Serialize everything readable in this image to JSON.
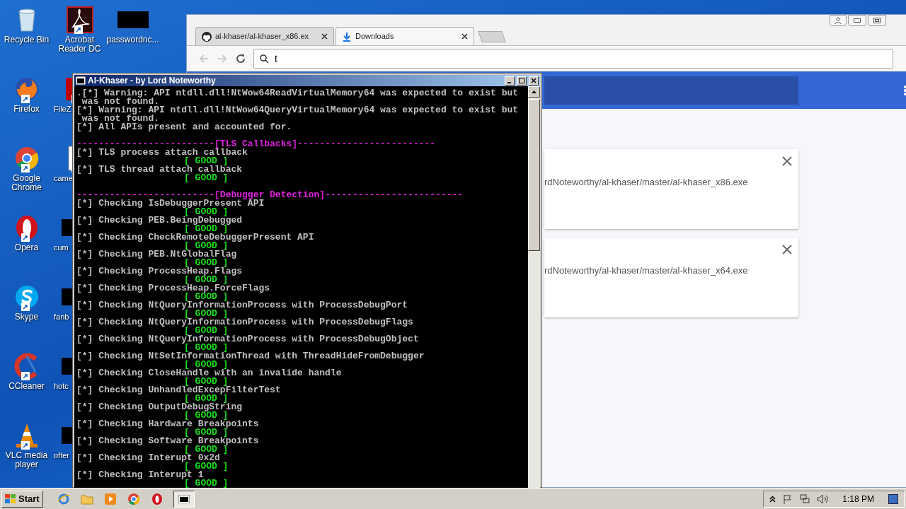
{
  "desktop_icons": [
    {
      "label": "Recycle Bin",
      "kind": "recycle"
    },
    {
      "label": "Firefox",
      "kind": "firefox"
    },
    {
      "label": "Google Chrome",
      "kind": "chrome"
    },
    {
      "label": "Opera",
      "kind": "opera"
    },
    {
      "label": "Skype",
      "kind": "skype"
    },
    {
      "label": "CCleaner",
      "kind": "ccleaner"
    },
    {
      "label": "VLC media player",
      "kind": "vlc"
    },
    {
      "label": "Acrobat Reader DC",
      "kind": "pdf"
    },
    {
      "label": "FileZ",
      "kind": "filezilla"
    },
    {
      "label": "came",
      "kind": "file"
    },
    {
      "label": "cum",
      "kind": "black"
    },
    {
      "label": "fanb",
      "kind": "black"
    },
    {
      "label": "hotc",
      "kind": "black"
    },
    {
      "label": "ofter",
      "kind": "black"
    },
    {
      "label": "passwordnc...",
      "kind": "black"
    }
  ],
  "browser": {
    "tabs": [
      {
        "label": "al-khaser/al-khaser_x86.ex",
        "kind": "github",
        "selected": false
      },
      {
        "label": "Downloads",
        "kind": "download",
        "selected": true
      }
    ],
    "omnibox": {
      "value": "t"
    },
    "downloads": [
      {
        "url": "rdNoteworthy/al-khaser/master/al-khaser_x86.exe"
      },
      {
        "url": "rdNoteworthy/al-khaser/master/al-khaser_x64.exe"
      }
    ]
  },
  "console": {
    "title": "Al-Khaser - by Lord Noteworthy",
    "lines": [
      {
        "kind": "text",
        "text": ".[*] Warning: API ntdll.dll!NtWow64ReadVirtualMemory64 was expected to exist but"
      },
      {
        "kind": "text",
        "text": " was not found."
      },
      {
        "kind": "text",
        "text": "[*] Warning: API ntdll.dll!NtWow64QueryVirtualMemory64 was expected to exist but"
      },
      {
        "kind": "text",
        "text": " was not found."
      },
      {
        "kind": "text",
        "text": "[*] All APIs present and accounted for."
      },
      {
        "kind": "blank"
      },
      {
        "kind": "header",
        "text": "-------------------------[TLS Callbacks]-------------------------"
      },
      {
        "kind": "text",
        "text": "[*] TLS process attach callback"
      },
      {
        "kind": "good",
        "text": "[ GOOD ]"
      },
      {
        "kind": "text",
        "text": "[*] TLS thread attach callback"
      },
      {
        "kind": "good",
        "text": "[ GOOD ]"
      },
      {
        "kind": "blank"
      },
      {
        "kind": "header",
        "text": "-------------------------[Debugger Detection]-------------------------"
      },
      {
        "kind": "text",
        "text": "[*] Checking IsDebuggerPresent API"
      },
      {
        "kind": "good",
        "text": "[ GOOD ]"
      },
      {
        "kind": "text",
        "text": "[*] Checking PEB.BeingDebugged"
      },
      {
        "kind": "good",
        "text": "[ GOOD ]"
      },
      {
        "kind": "text",
        "text": "[*] Checking CheckRemoteDebuggerPresent API"
      },
      {
        "kind": "good",
        "text": "[ GOOD ]"
      },
      {
        "kind": "text",
        "text": "[*] Checking PEB.NtGlobalFlag"
      },
      {
        "kind": "good",
        "text": "[ GOOD ]"
      },
      {
        "kind": "text",
        "text": "[*] Checking ProcessHeap.Flags"
      },
      {
        "kind": "good",
        "text": "[ GOOD ]"
      },
      {
        "kind": "text",
        "text": "[*] Checking ProcessHeap.ForceFlags"
      },
      {
        "kind": "good",
        "text": "[ GOOD ]"
      },
      {
        "kind": "text",
        "text": "[*] Checking NtQueryInformationProcess with ProcessDebugPort"
      },
      {
        "kind": "good",
        "text": "[ GOOD ]"
      },
      {
        "kind": "text",
        "text": "[*] Checking NtQueryInformationProcess with ProcessDebugFlags"
      },
      {
        "kind": "good",
        "text": "[ GOOD ]"
      },
      {
        "kind": "text",
        "text": "[*] Checking NtQueryInformationProcess with ProcessDebugObject"
      },
      {
        "kind": "good",
        "text": "[ GOOD ]"
      },
      {
        "kind": "text",
        "text": "[*] Checking NtSetInformationThread with ThreadHideFromDebugger"
      },
      {
        "kind": "good",
        "text": "[ GOOD ]"
      },
      {
        "kind": "text",
        "text": "[*] Checking CloseHandle with an invalide handle"
      },
      {
        "kind": "good",
        "text": "[ GOOD ]"
      },
      {
        "kind": "text",
        "text": "[*] Checking UnhandledExcepFilterTest"
      },
      {
        "kind": "good",
        "text": "[ GOOD ]"
      },
      {
        "kind": "text",
        "text": "[*] Checking OutputDebugString"
      },
      {
        "kind": "good",
        "text": "[ GOOD ]"
      },
      {
        "kind": "text",
        "text": "[*] Checking Hardware Breakpoints"
      },
      {
        "kind": "good",
        "text": "[ GOOD ]"
      },
      {
        "kind": "text",
        "text": "[*] Checking Software Breakpoints"
      },
      {
        "kind": "good",
        "text": "[ GOOD ]"
      },
      {
        "kind": "text",
        "text": "[*] Checking Interupt 0x2d"
      },
      {
        "kind": "good",
        "text": "[ GOOD ]"
      },
      {
        "kind": "text",
        "text": "[*] Checking Interupt 1"
      },
      {
        "kind": "good",
        "text": "[ GOOD ]"
      }
    ]
  },
  "taskbar": {
    "start": "Start",
    "quick_launch": [
      {
        "kind": "ie"
      },
      {
        "kind": "folder"
      },
      {
        "kind": "media"
      },
      {
        "kind": "chrome"
      },
      {
        "kind": "opera"
      }
    ],
    "tasks": [
      {
        "kind": "console",
        "selected": true
      }
    ],
    "clock": "1:18 PM"
  }
}
